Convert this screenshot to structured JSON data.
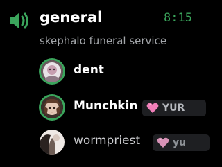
{
  "channel": {
    "name": "general",
    "elapsed": "8:15",
    "topic": "skephalo funeral service",
    "icon": "speaker-icon"
  },
  "colors": {
    "speaking_ring": "#3ba55c",
    "elapsed_text": "#3ba55c",
    "background": "#000000",
    "topic_text": "#a3a6aa"
  },
  "members": [
    {
      "name": "dent",
      "speaking": true,
      "activity": ""
    },
    {
      "name": "Munchkin",
      "speaking": true,
      "activity": "YUR"
    },
    {
      "name": "wormpriest",
      "speaking": false,
      "activity": "yu"
    }
  ]
}
